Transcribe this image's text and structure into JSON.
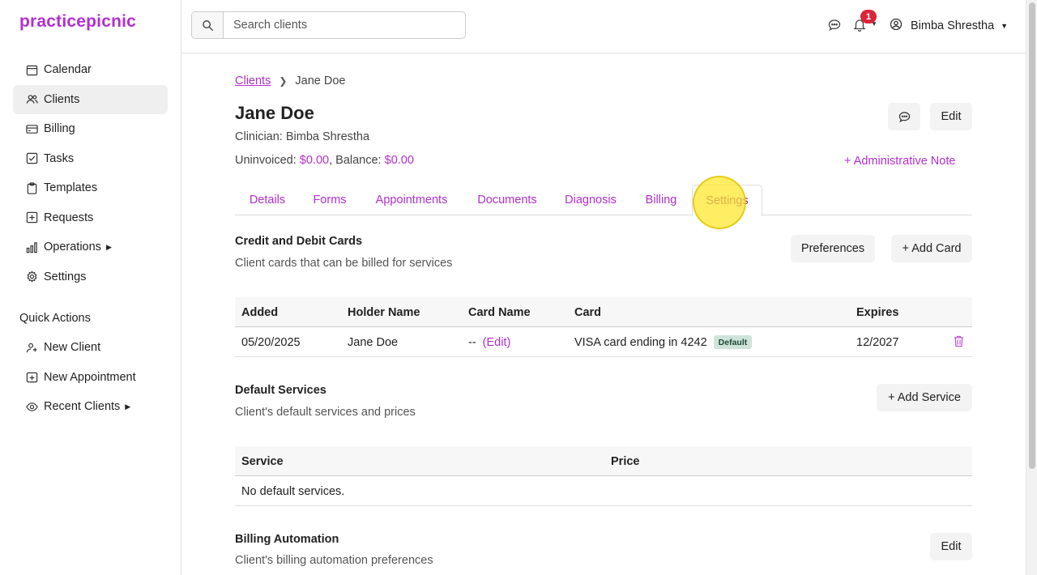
{
  "app": {
    "logo": "practicepicnic"
  },
  "sidebar": {
    "items": [
      {
        "label": "Calendar",
        "icon": "calendar-icon"
      },
      {
        "label": "Clients",
        "icon": "users-icon",
        "active": true
      },
      {
        "label": "Billing",
        "icon": "credit-card-icon"
      },
      {
        "label": "Tasks",
        "icon": "checkbox-icon"
      },
      {
        "label": "Templates",
        "icon": "clipboard-icon"
      },
      {
        "label": "Requests",
        "icon": "inbox-icon"
      },
      {
        "label": "Operations",
        "icon": "bar-chart-icon",
        "expandable": true
      },
      {
        "label": "Settings",
        "icon": "gear-icon"
      }
    ],
    "quick_actions_title": "Quick Actions",
    "quick_actions": [
      {
        "label": "New Client",
        "icon": "user-plus-icon"
      },
      {
        "label": "New Appointment",
        "icon": "calendar-plus-icon"
      },
      {
        "label": "Recent Clients",
        "icon": "eye-icon",
        "expandable": true
      }
    ]
  },
  "topbar": {
    "search_placeholder": "Search clients",
    "notification_count": "1",
    "user_name": "Bimba Shrestha"
  },
  "breadcrumb": {
    "parent": "Clients",
    "current": "Jane Doe"
  },
  "client": {
    "name": "Jane Doe",
    "clinician_label": "Clinician:",
    "clinician": "Bimba Shrestha",
    "uninvoiced_label": "Uninvoiced:",
    "uninvoiced": "$0.00",
    "balance_label": "Balance:",
    "balance": "$0.00"
  },
  "actions": {
    "edit": "Edit",
    "admin_note": "+ Administrative Note"
  },
  "tabs": [
    "Details",
    "Forms",
    "Appointments",
    "Documents",
    "Diagnosis",
    "Billing",
    "Settings"
  ],
  "active_tab": "Settings",
  "cards_section": {
    "title": "Credit and Debit Cards",
    "subtitle": "Client cards that can be billed for services",
    "preferences_button": "Preferences",
    "add_button": "+ Add Card",
    "columns": [
      "Added",
      "Holder Name",
      "Card Name",
      "Card",
      "Expires"
    ],
    "rows": [
      {
        "added": "05/20/2025",
        "holder": "Jane Doe",
        "card_name": "--",
        "card_name_edit": "(Edit)",
        "card": "VISA card ending in 4242",
        "default_tag": "Default",
        "expires": "12/2027"
      }
    ]
  },
  "services_section": {
    "title": "Default Services",
    "subtitle": "Client's default services and prices",
    "add_button": "+ Add Service",
    "columns": [
      "Service",
      "Price"
    ],
    "empty_text": "No default services."
  },
  "automation_section": {
    "title": "Billing Automation",
    "subtitle": "Client's billing automation preferences",
    "edit_button": "Edit"
  },
  "colors": {
    "accent": "#b22fcf",
    "badge": "#d9263a",
    "default_tag_bg": "#cfe3da"
  }
}
